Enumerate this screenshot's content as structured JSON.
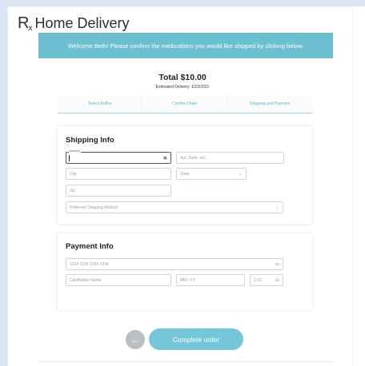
{
  "brand": {
    "rx": "R",
    "rx_sub": "x",
    "name": "Home Delivery"
  },
  "banner": {
    "text": "Welcome Beth! Please confirm the medications you would like shipped by clicking below."
  },
  "order": {
    "total": "Total $10.00",
    "delivery": "Estimated Delivery: 1/23/2021"
  },
  "steps": [
    "Select Refills",
    "Confirm Order",
    "Shipping and Payment"
  ],
  "shipping": {
    "title": "Shipping Info",
    "address_label": "Address",
    "address_value": "",
    "apt_placeholder": "Apt, Suite, etc...",
    "city_placeholder": "City",
    "state_placeholder": "State",
    "zip_placeholder": "Zip",
    "method_placeholder": "Preferred Shipping Method"
  },
  "payment": {
    "title": "Payment Info",
    "card_placeholder": "1234 1234 1234 1234",
    "name_placeholder": "Cardholder Name",
    "expiry_placeholder": "MM / YY",
    "cvc_placeholder": "CVC"
  },
  "actions": {
    "back_icon": "arrow-left-icon",
    "complete_label": "Complete order"
  },
  "colors": {
    "accent": "#6bbfd1",
    "button": "#74c7d9",
    "back_button": "#b9bfc5"
  }
}
